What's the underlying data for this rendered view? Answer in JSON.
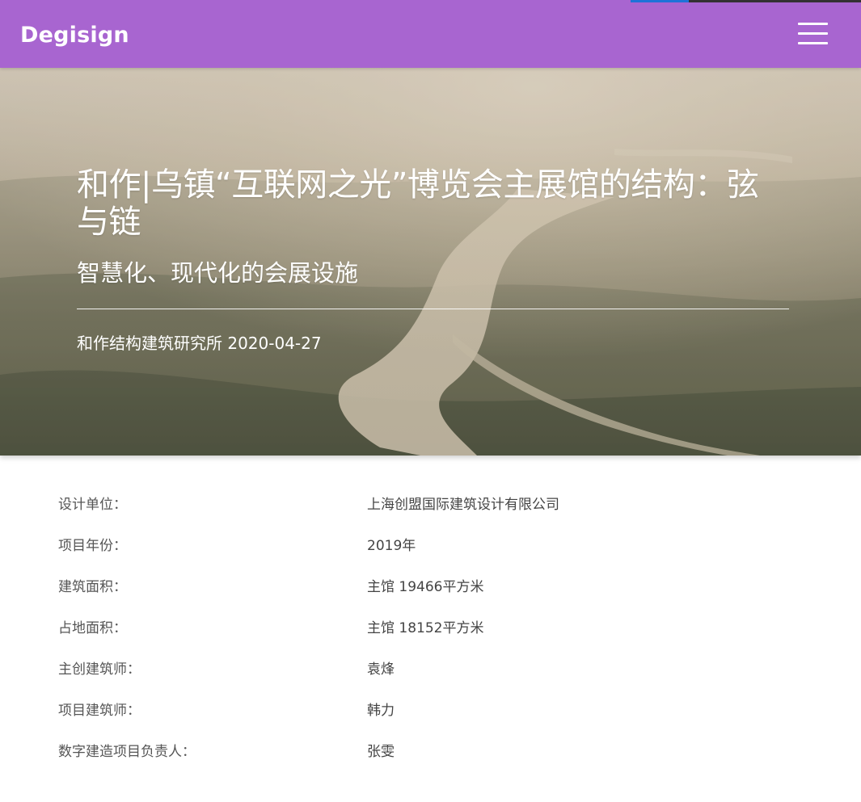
{
  "header": {
    "brand": "Degisign",
    "menu_icon": "hamburger-menu-icon",
    "colors": {
      "bar": "#a865d0",
      "accent_blue": "#1e72d8",
      "accent_dark": "#333133"
    }
  },
  "hero": {
    "title": "和作|乌镇“互联网之光”博览会主展馆的结构：弦与链",
    "subtitle": "智慧化、现代化的会展设施",
    "meta": "和作结构建筑研究所 2020-04-27"
  },
  "info": {
    "rows": [
      {
        "label": "设计单位：",
        "value": "上海创盟国际建筑设计有限公司"
      },
      {
        "label": "项目年份：",
        "value": "2019年"
      },
      {
        "label": "建筑面积：",
        "value": "主馆 19466平方米"
      },
      {
        "label": "占地面积：",
        "value": "主馆 18152平方米"
      },
      {
        "label": "主创建筑师：",
        "value": "袁烽"
      },
      {
        "label": "项目建筑师：",
        "value": "韩力"
      },
      {
        "label": "数字建造项目负责人：",
        "value": "张雯"
      }
    ]
  }
}
